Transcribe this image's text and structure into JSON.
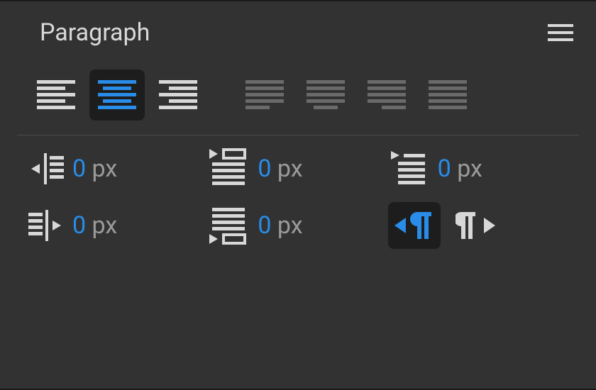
{
  "panel": {
    "title": "Paragraph"
  },
  "alignment": {
    "selected": "center",
    "buttons": [
      "left",
      "center",
      "right",
      "justify-last-left",
      "justify-last-center",
      "justify-last-right",
      "justify-all"
    ]
  },
  "indent": {
    "left": {
      "value": "0",
      "unit": "px"
    },
    "right": {
      "value": "0",
      "unit": "px"
    },
    "firstline": {
      "value": "0",
      "unit": "px"
    },
    "lastline": {
      "value": "0",
      "unit": "px"
    },
    "space_before": {
      "value": "0",
      "unit": "px"
    }
  },
  "direction": {
    "selected": "ltr"
  },
  "colors": {
    "icon_active": "#d8d8d8",
    "icon_selected": "#288ce8",
    "icon_dim": "#6a6a6a"
  }
}
